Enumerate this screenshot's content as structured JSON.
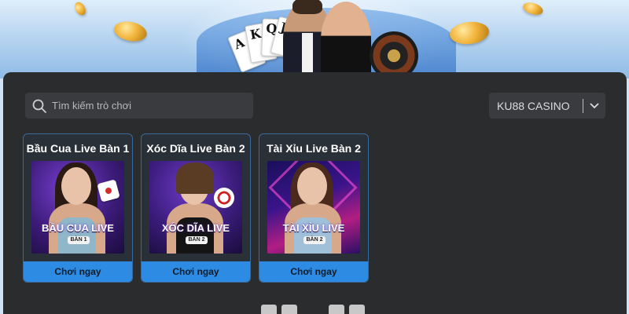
{
  "banner": {
    "cards": [
      "A",
      "K",
      "Q",
      "J"
    ]
  },
  "search": {
    "placeholder": "Tìm kiếm trò chơi"
  },
  "provider_select": {
    "selected": "KU88 CASINO"
  },
  "games": [
    {
      "title": "Bầu Cua Live Bàn 1",
      "logo": "BẦU CUA LIVE",
      "badge": "BÀN 1",
      "play_label": "Chơi ngay"
    },
    {
      "title": "Xóc Dĩa Live Bàn 2",
      "logo": "XÓC DĨA LIVE",
      "badge": "BÀN 2",
      "play_label": "Chơi ngay"
    },
    {
      "title": "Tài Xỉu Live Bàn 2",
      "logo": "TÀI XỈU LIVE",
      "badge": "BÀN 2",
      "play_label": "Chơi ngay"
    }
  ],
  "colors": {
    "panel": "#2b2c2e",
    "input": "#3a3b3e",
    "accent": "#2e8be3"
  }
}
